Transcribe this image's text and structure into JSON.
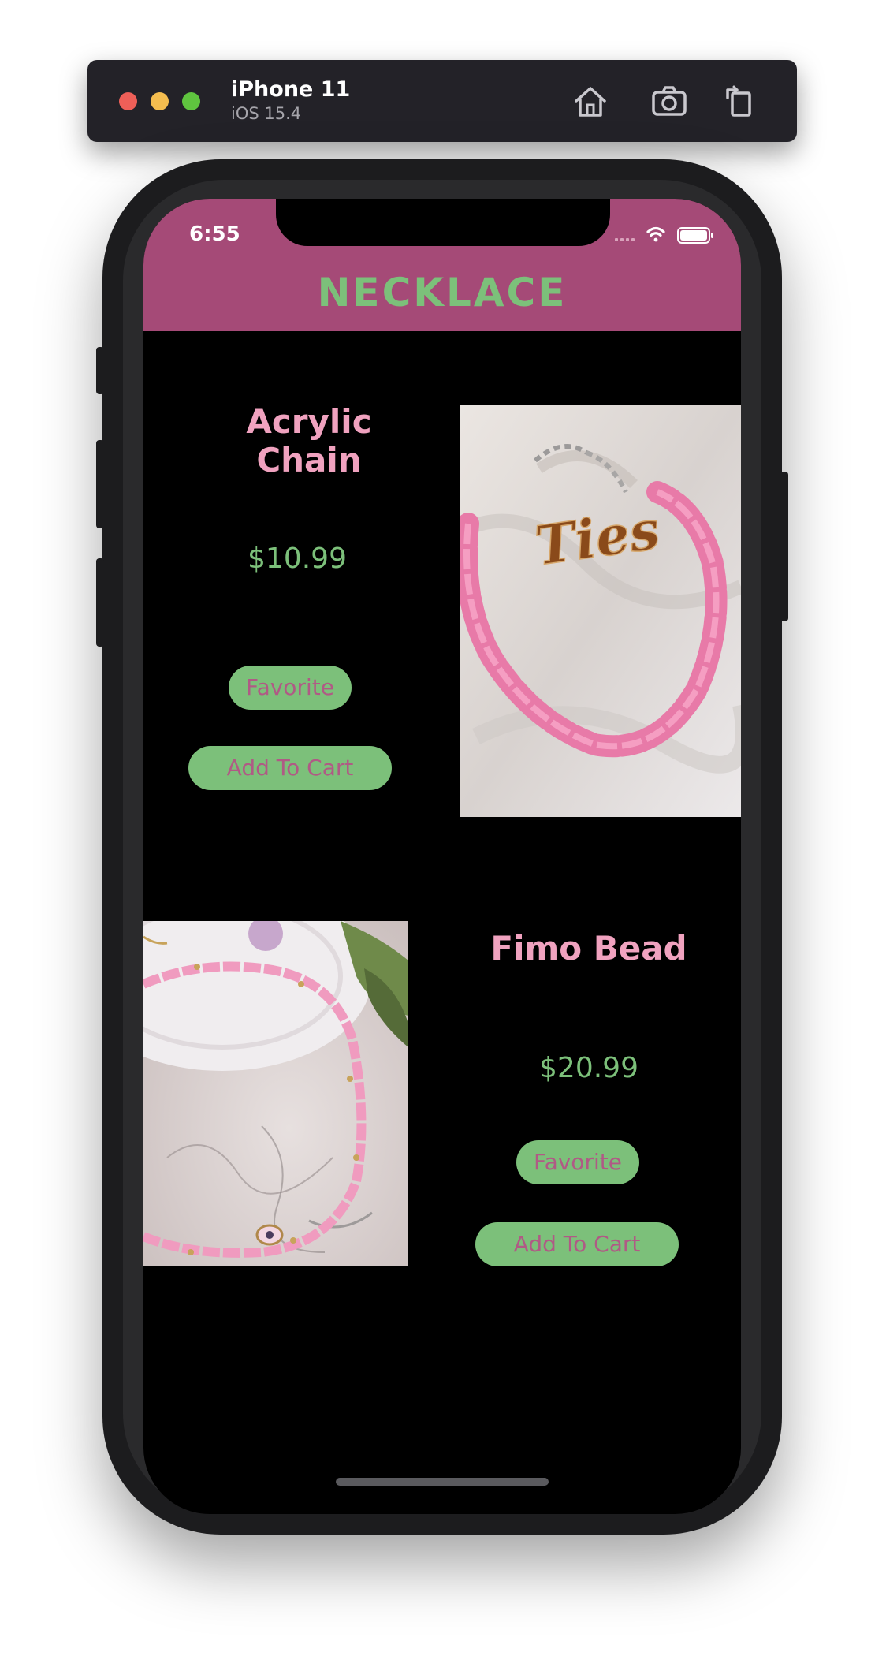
{
  "simulator": {
    "device_name": "iPhone 11",
    "os_version": "iOS 15.4",
    "toolbar_icons": [
      "home-icon",
      "screenshot-icon",
      "rotate-icon"
    ]
  },
  "status_bar": {
    "time": "6:55",
    "icons": [
      "cellular-icon",
      "wifi-icon",
      "battery-icon"
    ]
  },
  "nav": {
    "title": "NECKLACE"
  },
  "products": [
    {
      "title": "Acrylic Chain",
      "price": "$10.99",
      "favorite_label": "Favorite",
      "cart_label": "Add To Cart",
      "image_text": "Ties"
    },
    {
      "title": "Fimo Bead",
      "price": "$20.99",
      "favorite_label": "Favorite",
      "cart_label": "Add To Cart"
    }
  ],
  "colors": {
    "accent_nav": "#a54a77",
    "green": "#7cc07a",
    "pink_title": "#f0a2bf",
    "button_text": "#b05a85"
  }
}
